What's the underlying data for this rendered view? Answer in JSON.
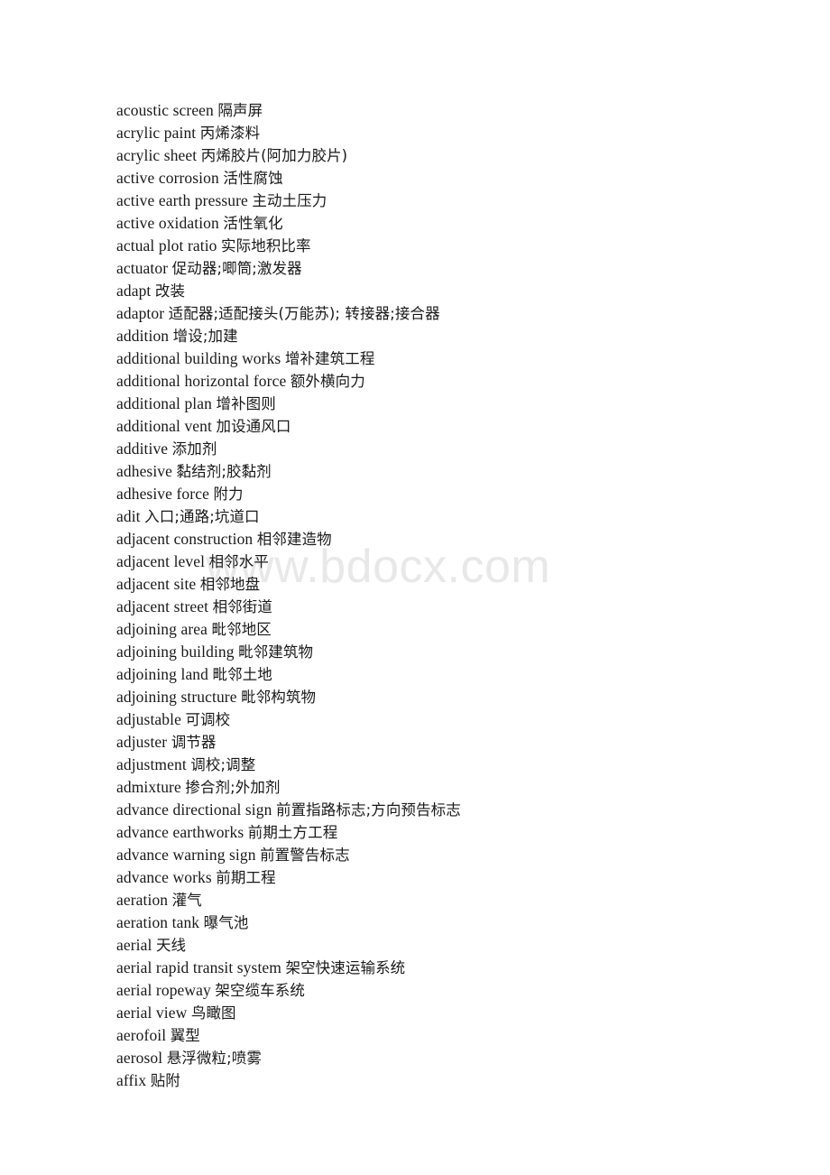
{
  "document": {
    "watermark": "www.bdocx.com",
    "text_color": "#1a1a1a",
    "watermark_color": "#e8e8e8",
    "background_color": "#ffffff",
    "entries": [
      {
        "term": "acoustic screen",
        "gloss": "隔声屏"
      },
      {
        "term": "acrylic paint",
        "gloss": "丙烯漆料"
      },
      {
        "term": "acrylic sheet",
        "gloss": "丙烯胶片(阿加力胶片)"
      },
      {
        "term": "active corrosion",
        "gloss": "活性腐蚀"
      },
      {
        "term": "active earth pressure",
        "gloss": "主动土压力"
      },
      {
        "term": "active oxidation",
        "gloss": "活性氧化"
      },
      {
        "term": "actual plot ratio",
        "gloss": "实际地积比率"
      },
      {
        "term": "actuator",
        "gloss": "促动器;唧筒;激发器"
      },
      {
        "term": "adapt",
        "gloss": "改装"
      },
      {
        "term": "adaptor",
        "gloss": "适配器;适配接头(万能苏); 转接器;接合器"
      },
      {
        "term": "addition",
        "gloss": "增设;加建"
      },
      {
        "term": "additional building works",
        "gloss": "增补建筑工程"
      },
      {
        "term": "additional horizontal force",
        "gloss": "额外横向力"
      },
      {
        "term": "additional plan",
        "gloss": "增补图则"
      },
      {
        "term": "additional vent",
        "gloss": "加设通风口"
      },
      {
        "term": "additive",
        "gloss": "添加剂"
      },
      {
        "term": "adhesive",
        "gloss": "黏结剂;胶黏剂"
      },
      {
        "term": "adhesive force",
        "gloss": "附力"
      },
      {
        "term": "adit",
        "gloss": "入口;通路;坑道口"
      },
      {
        "term": "adjacent construction",
        "gloss": "相邻建造物"
      },
      {
        "term": "adjacent level",
        "gloss": "相邻水平"
      },
      {
        "term": "adjacent site",
        "gloss": "相邻地盘"
      },
      {
        "term": "adjacent street",
        "gloss": "相邻街道"
      },
      {
        "term": "adjoining area",
        "gloss": "毗邻地区"
      },
      {
        "term": "adjoining building",
        "gloss": "毗邻建筑物"
      },
      {
        "term": "adjoining land",
        "gloss": "毗邻土地"
      },
      {
        "term": "adjoining structure",
        "gloss": "毗邻构筑物"
      },
      {
        "term": "adjustable",
        "gloss": "可调校"
      },
      {
        "term": "adjuster",
        "gloss": "调节器"
      },
      {
        "term": "adjustment",
        "gloss": "调校;调整"
      },
      {
        "term": "admixture",
        "gloss": "掺合剂;外加剂"
      },
      {
        "term": "advance directional sign",
        "gloss": "前置指路标志;方向预告标志"
      },
      {
        "term": "advance earthworks",
        "gloss": "前期土方工程"
      },
      {
        "term": "advance warning sign",
        "gloss": "前置警告标志"
      },
      {
        "term": "advance works",
        "gloss": "前期工程"
      },
      {
        "term": "aeration",
        "gloss": "灌气"
      },
      {
        "term": "aeration tank",
        "gloss": "曝气池"
      },
      {
        "term": "aerial",
        "gloss": "天线"
      },
      {
        "term": "aerial rapid transit system",
        "gloss": "架空快速运输系统"
      },
      {
        "term": "aerial ropeway",
        "gloss": "架空缆车系统"
      },
      {
        "term": "aerial view",
        "gloss": "鸟瞰图"
      },
      {
        "term": "aerofoil",
        "gloss": "翼型"
      },
      {
        "term": "aerosol",
        "gloss": "悬浮微粒;喷雾"
      },
      {
        "term": "affix",
        "gloss": "贴附"
      }
    ]
  }
}
